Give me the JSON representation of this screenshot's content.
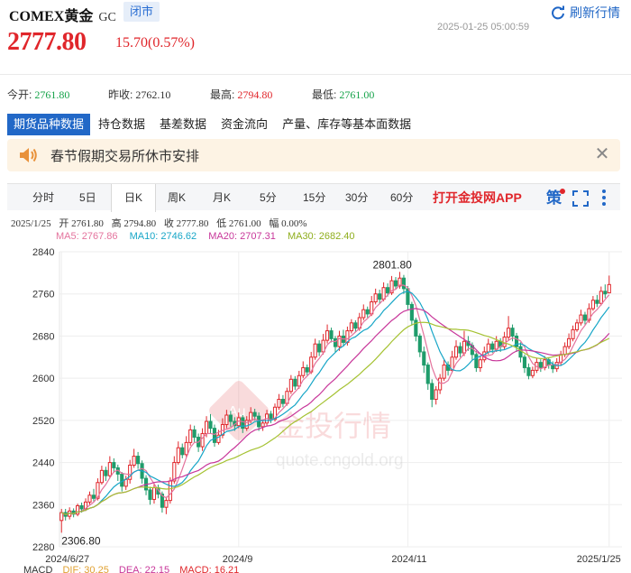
{
  "header": {
    "name": "COMEX黄金",
    "code": "GC",
    "status": "闭市",
    "refresh_label": "刷新行情",
    "timestamp": "2025-01-25 05:00:59",
    "price": "2777.80",
    "change": "15.70(0.57%)"
  },
  "stats": {
    "open_label": "今开:",
    "open": "2761.80",
    "prev_close_label": "昨收:",
    "prev_close": "2762.10",
    "high_label": "最高:",
    "high": "2794.80",
    "low_label": "最低:",
    "low": "2761.00"
  },
  "tabs": [
    "期货品种数据",
    "持仓数据",
    "基差数据",
    "资金流向",
    "产量、库存等基本面数据"
  ],
  "notice": {
    "text": "春节假期交易所休市安排"
  },
  "periods": [
    "分时",
    "5日",
    "日K",
    "周K",
    "月K",
    "5分",
    "15分",
    "30分",
    "60分"
  ],
  "active_period": "日K",
  "app_link": "打开金投网APP",
  "policy_icon_text": "策",
  "ohlc_bar": {
    "date": "2025/1/25",
    "open": "开 2761.80",
    "high": "高 2794.80",
    "close": "收 2777.80",
    "low": "低 2761.00",
    "change": "幅 0.00%"
  },
  "ma_legend": {
    "ma5": "MA5: 2767.86",
    "ma10": "MA10: 2746.62",
    "ma20": "MA20: 2707.31",
    "ma30": "MA30: 2682.40"
  },
  "macd": {
    "label": "MACD",
    "dif": "DIF: 30.25",
    "dea": "DEA: 22.15",
    "macd": "MACD: 16.21"
  },
  "watermark": {
    "main": "金投行情",
    "sub": "quote.cngold.org",
    "logo": "Au"
  },
  "colors": {
    "up": "#e0262b",
    "down": "#1f9c6b",
    "ma5": "#e4739d",
    "ma10": "#17a6c7",
    "ma20": "#c8379a",
    "ma30": "#a5c232",
    "accent": "#2268c7"
  },
  "chart_data": {
    "type": "candlestick",
    "ylim": [
      2280,
      2840
    ],
    "yticks": [
      2280,
      2360,
      2440,
      2520,
      2600,
      2680,
      2760,
      2840
    ],
    "xticks": [
      "2024/6/27",
      "2024/9",
      "2024/11",
      "2025/1/25"
    ],
    "annotations": {
      "max": "2801.80",
      "min": "2306.80"
    },
    "candles": [
      [
        2330,
        2345,
        2306.8,
        2352
      ],
      [
        2345,
        2338,
        2330,
        2352
      ],
      [
        2338,
        2348,
        2332,
        2355
      ],
      [
        2348,
        2342,
        2336,
        2353
      ],
      [
        2342,
        2358,
        2338,
        2362
      ],
      [
        2358,
        2352,
        2345,
        2364
      ],
      [
        2352,
        2365,
        2348,
        2372
      ],
      [
        2365,
        2378,
        2360,
        2385
      ],
      [
        2378,
        2372,
        2366,
        2390
      ],
      [
        2372,
        2402,
        2368,
        2410
      ],
      [
        2402,
        2425,
        2398,
        2434
      ],
      [
        2425,
        2415,
        2405,
        2432
      ],
      [
        2415,
        2440,
        2410,
        2452
      ],
      [
        2440,
        2430,
        2421,
        2448
      ],
      [
        2430,
        2418,
        2405,
        2436
      ],
      [
        2418,
        2395,
        2385,
        2422
      ],
      [
        2395,
        2408,
        2388,
        2415
      ],
      [
        2408,
        2435,
        2400,
        2445
      ],
      [
        2435,
        2452,
        2430,
        2466
      ],
      [
        2452,
        2438,
        2428,
        2460
      ],
      [
        2438,
        2410,
        2400,
        2444
      ],
      [
        2410,
        2388,
        2378,
        2416
      ],
      [
        2388,
        2370,
        2360,
        2394
      ],
      [
        2370,
        2392,
        2362,
        2401
      ],
      [
        2392,
        2380,
        2372,
        2398
      ],
      [
        2380,
        2355,
        2345,
        2385
      ],
      [
        2355,
        2368,
        2342,
        2375
      ],
      [
        2368,
        2405,
        2362,
        2412
      ],
      [
        2405,
        2440,
        2400,
        2452
      ],
      [
        2440,
        2468,
        2436,
        2480
      ],
      [
        2468,
        2455,
        2448,
        2476
      ],
      [
        2455,
        2478,
        2450,
        2490
      ],
      [
        2478,
        2502,
        2472,
        2512
      ],
      [
        2502,
        2488,
        2478,
        2510
      ],
      [
        2488,
        2470,
        2460,
        2495
      ],
      [
        2470,
        2495,
        2462,
        2505
      ],
      [
        2495,
        2518,
        2488,
        2528
      ],
      [
        2518,
        2505,
        2495,
        2532
      ],
      [
        2505,
        2478,
        2470,
        2512
      ],
      [
        2478,
        2492,
        2474,
        2502
      ],
      [
        2492,
        2512,
        2486,
        2524
      ],
      [
        2512,
        2530,
        2505,
        2540
      ],
      [
        2530,
        2518,
        2508,
        2538
      ],
      [
        2518,
        2510,
        2500,
        2526
      ],
      [
        2510,
        2525,
        2505,
        2535
      ],
      [
        2525,
        2505,
        2496,
        2530
      ],
      [
        2505,
        2520,
        2500,
        2528
      ],
      [
        2520,
        2535,
        2515,
        2545
      ],
      [
        2535,
        2528,
        2520,
        2542
      ],
      [
        2528,
        2508,
        2500,
        2535
      ],
      [
        2508,
        2515,
        2500,
        2522
      ],
      [
        2515,
        2532,
        2510,
        2540
      ],
      [
        2532,
        2522,
        2515,
        2538
      ],
      [
        2522,
        2545,
        2518,
        2552
      ],
      [
        2545,
        2560,
        2540,
        2570
      ],
      [
        2560,
        2552,
        2545,
        2568
      ],
      [
        2552,
        2575,
        2548,
        2582
      ],
      [
        2575,
        2598,
        2570,
        2606
      ],
      [
        2598,
        2585,
        2578,
        2604
      ],
      [
        2585,
        2605,
        2580,
        2614
      ],
      [
        2605,
        2620,
        2600,
        2632
      ],
      [
        2620,
        2612,
        2605,
        2626
      ],
      [
        2612,
        2640,
        2608,
        2650
      ],
      [
        2640,
        2665,
        2635,
        2675
      ],
      [
        2665,
        2650,
        2642,
        2672
      ],
      [
        2650,
        2672,
        2645,
        2684
      ],
      [
        2672,
        2690,
        2666,
        2702
      ],
      [
        2690,
        2675,
        2668,
        2696
      ],
      [
        2675,
        2660,
        2650,
        2680
      ],
      [
        2660,
        2680,
        2652,
        2690
      ],
      [
        2680,
        2668,
        2660,
        2692
      ],
      [
        2668,
        2690,
        2662,
        2698
      ],
      [
        2690,
        2705,
        2685,
        2712
      ],
      [
        2705,
        2695,
        2688,
        2710
      ],
      [
        2695,
        2715,
        2690,
        2724
      ],
      [
        2715,
        2730,
        2710,
        2740
      ],
      [
        2730,
        2722,
        2715,
        2736
      ],
      [
        2722,
        2745,
        2718,
        2756
      ],
      [
        2745,
        2760,
        2740,
        2770
      ],
      [
        2760,
        2750,
        2742,
        2768
      ],
      [
        2750,
        2772,
        2746,
        2782
      ],
      [
        2772,
        2762,
        2755,
        2780
      ],
      [
        2762,
        2785,
        2758,
        2794
      ],
      [
        2785,
        2775,
        2768,
        2792
      ],
      [
        2775,
        2790,
        2770,
        2801.8
      ],
      [
        2790,
        2770,
        2760,
        2796
      ],
      [
        2770,
        2740,
        2730,
        2775
      ],
      [
        2740,
        2710,
        2700,
        2745
      ],
      [
        2710,
        2680,
        2670,
        2715
      ],
      [
        2680,
        2650,
        2640,
        2685
      ],
      [
        2650,
        2625,
        2610,
        2660
      ],
      [
        2625,
        2590,
        2578,
        2630
      ],
      [
        2590,
        2560,
        2545,
        2598
      ],
      [
        2560,
        2578,
        2550,
        2585
      ],
      [
        2578,
        2600,
        2570,
        2608
      ],
      [
        2600,
        2625,
        2595,
        2635
      ],
      [
        2625,
        2615,
        2605,
        2632
      ],
      [
        2615,
        2640,
        2610,
        2652
      ],
      [
        2640,
        2660,
        2635,
        2672
      ],
      [
        2660,
        2648,
        2640,
        2668
      ],
      [
        2648,
        2670,
        2642,
        2690
      ],
      [
        2670,
        2662,
        2652,
        2680
      ],
      [
        2662,
        2645,
        2635,
        2668
      ],
      [
        2645,
        2620,
        2612,
        2652
      ],
      [
        2620,
        2635,
        2612,
        2642
      ],
      [
        2635,
        2650,
        2630,
        2660
      ],
      [
        2650,
        2665,
        2645,
        2675
      ],
      [
        2665,
        2655,
        2648,
        2670
      ],
      [
        2655,
        2670,
        2650,
        2680
      ],
      [
        2670,
        2660,
        2650,
        2676
      ],
      [
        2660,
        2678,
        2655,
        2688
      ],
      [
        2678,
        2695,
        2672,
        2718
      ],
      [
        2695,
        2680,
        2670,
        2702
      ],
      [
        2680,
        2660,
        2650,
        2686
      ],
      [
        2660,
        2640,
        2630,
        2668
      ],
      [
        2640,
        2620,
        2610,
        2645
      ],
      [
        2620,
        2605,
        2598,
        2628
      ],
      [
        2605,
        2615,
        2600,
        2622
      ],
      [
        2615,
        2630,
        2610,
        2638
      ],
      [
        2630,
        2620,
        2612,
        2636
      ],
      [
        2620,
        2635,
        2615,
        2642
      ],
      [
        2635,
        2625,
        2618,
        2640
      ],
      [
        2625,
        2618,
        2610,
        2632
      ],
      [
        2618,
        2630,
        2612,
        2638
      ],
      [
        2630,
        2645,
        2625,
        2652
      ],
      [
        2645,
        2660,
        2640,
        2668
      ],
      [
        2660,
        2675,
        2655,
        2685
      ],
      [
        2675,
        2692,
        2670,
        2700
      ],
      [
        2692,
        2705,
        2688,
        2712
      ],
      [
        2705,
        2720,
        2700,
        2730
      ],
      [
        2720,
        2710,
        2702,
        2726
      ],
      [
        2710,
        2732,
        2705,
        2742
      ],
      [
        2732,
        2748,
        2728,
        2756
      ],
      [
        2748,
        2742,
        2735,
        2758
      ],
      [
        2742,
        2765,
        2738,
        2774
      ],
      [
        2765,
        2760,
        2752,
        2778
      ],
      [
        2762.1,
        2777.8,
        2761,
        2794.8
      ]
    ]
  }
}
